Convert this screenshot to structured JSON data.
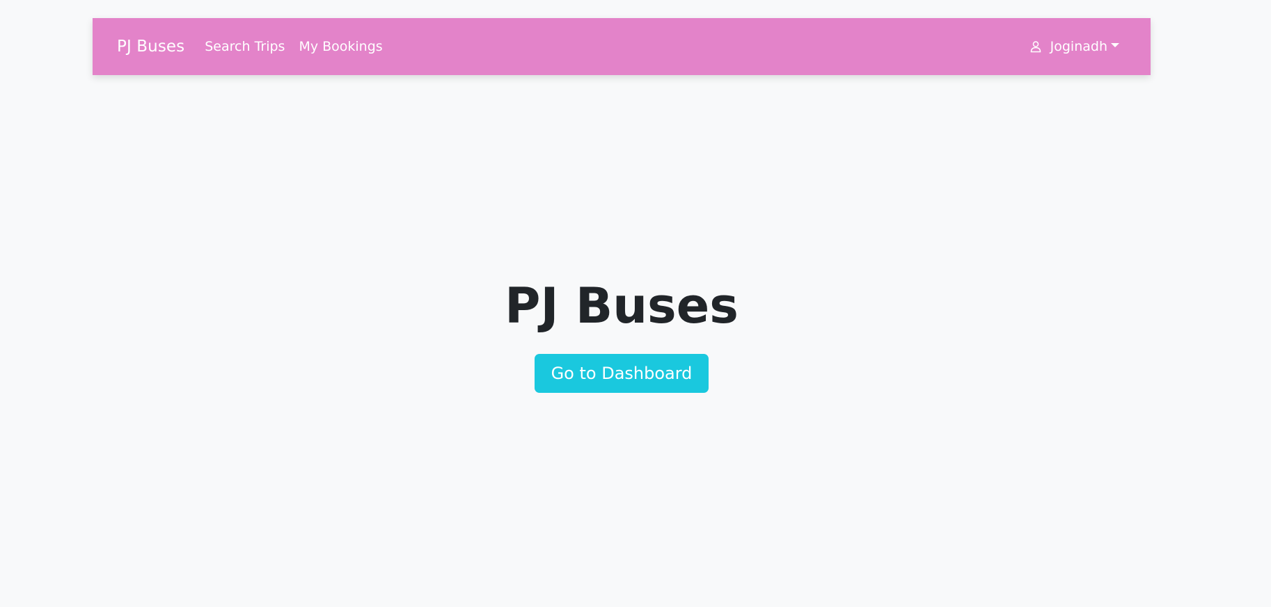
{
  "navbar": {
    "brand": "PJ Buses",
    "links": [
      {
        "label": "Search Trips"
      },
      {
        "label": "My Bookings"
      }
    ],
    "user": {
      "icon": "user-icon",
      "name": "Joginadh"
    },
    "background_color": "#e383c9"
  },
  "hero": {
    "title": "PJ Buses",
    "cta_label": "Go to Dashboard",
    "cta_color": "#1ac8de"
  }
}
